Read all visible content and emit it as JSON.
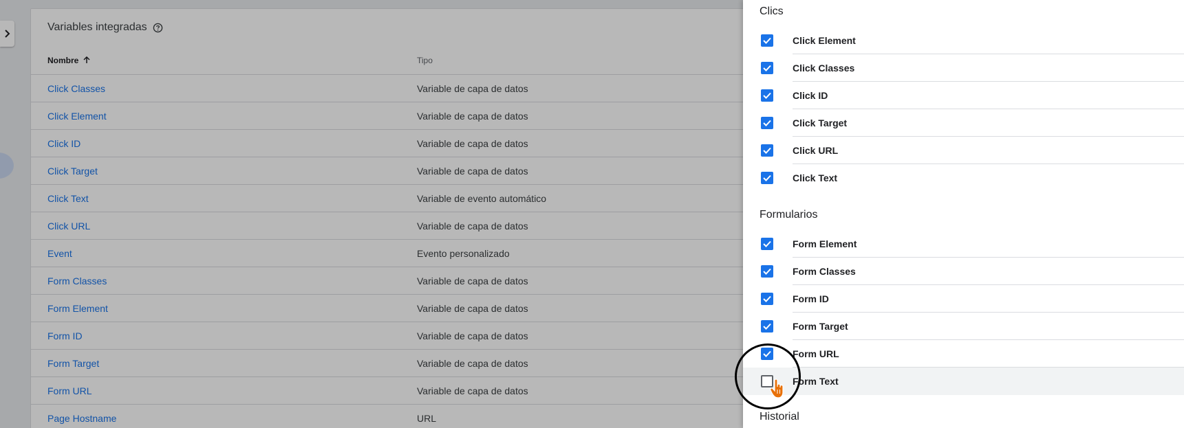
{
  "background": {
    "card_title": "Variables integradas",
    "columns": {
      "name": "Nombre",
      "type": "Tipo"
    },
    "rows": [
      {
        "name": "Click Classes",
        "type": "Variable de capa de datos"
      },
      {
        "name": "Click Element",
        "type": "Variable de capa de datos"
      },
      {
        "name": "Click ID",
        "type": "Variable de capa de datos"
      },
      {
        "name": "Click Target",
        "type": "Variable de capa de datos"
      },
      {
        "name": "Click Text",
        "type": "Variable de evento automático"
      },
      {
        "name": "Click URL",
        "type": "Variable de capa de datos"
      },
      {
        "name": "Event",
        "type": "Evento personalizado"
      },
      {
        "name": "Form Classes",
        "type": "Variable de capa de datos"
      },
      {
        "name": "Form Element",
        "type": "Variable de capa de datos"
      },
      {
        "name": "Form ID",
        "type": "Variable de capa de datos"
      },
      {
        "name": "Form Target",
        "type": "Variable de capa de datos"
      },
      {
        "name": "Form URL",
        "type": "Variable de capa de datos"
      },
      {
        "name": "Page Hostname",
        "type": "URL"
      }
    ]
  },
  "drawer": {
    "sections": [
      {
        "title": "Clics",
        "items": [
          {
            "label": "Click Element",
            "checked": true
          },
          {
            "label": "Click Classes",
            "checked": true
          },
          {
            "label": "Click ID",
            "checked": true
          },
          {
            "label": "Click Target",
            "checked": true
          },
          {
            "label": "Click URL",
            "checked": true
          },
          {
            "label": "Click Text",
            "checked": true
          }
        ]
      },
      {
        "title": "Formularios",
        "items": [
          {
            "label": "Form Element",
            "checked": true
          },
          {
            "label": "Form Classes",
            "checked": true
          },
          {
            "label": "Form ID",
            "checked": true
          },
          {
            "label": "Form Target",
            "checked": true
          },
          {
            "label": "Form URL",
            "checked": true
          },
          {
            "label": "Form Text",
            "checked": false
          }
        ]
      },
      {
        "title": "Historial",
        "items": []
      }
    ]
  },
  "colors": {
    "accent": "#1a73e8",
    "link": "#1a73e8",
    "cursor": "#e8710a"
  }
}
